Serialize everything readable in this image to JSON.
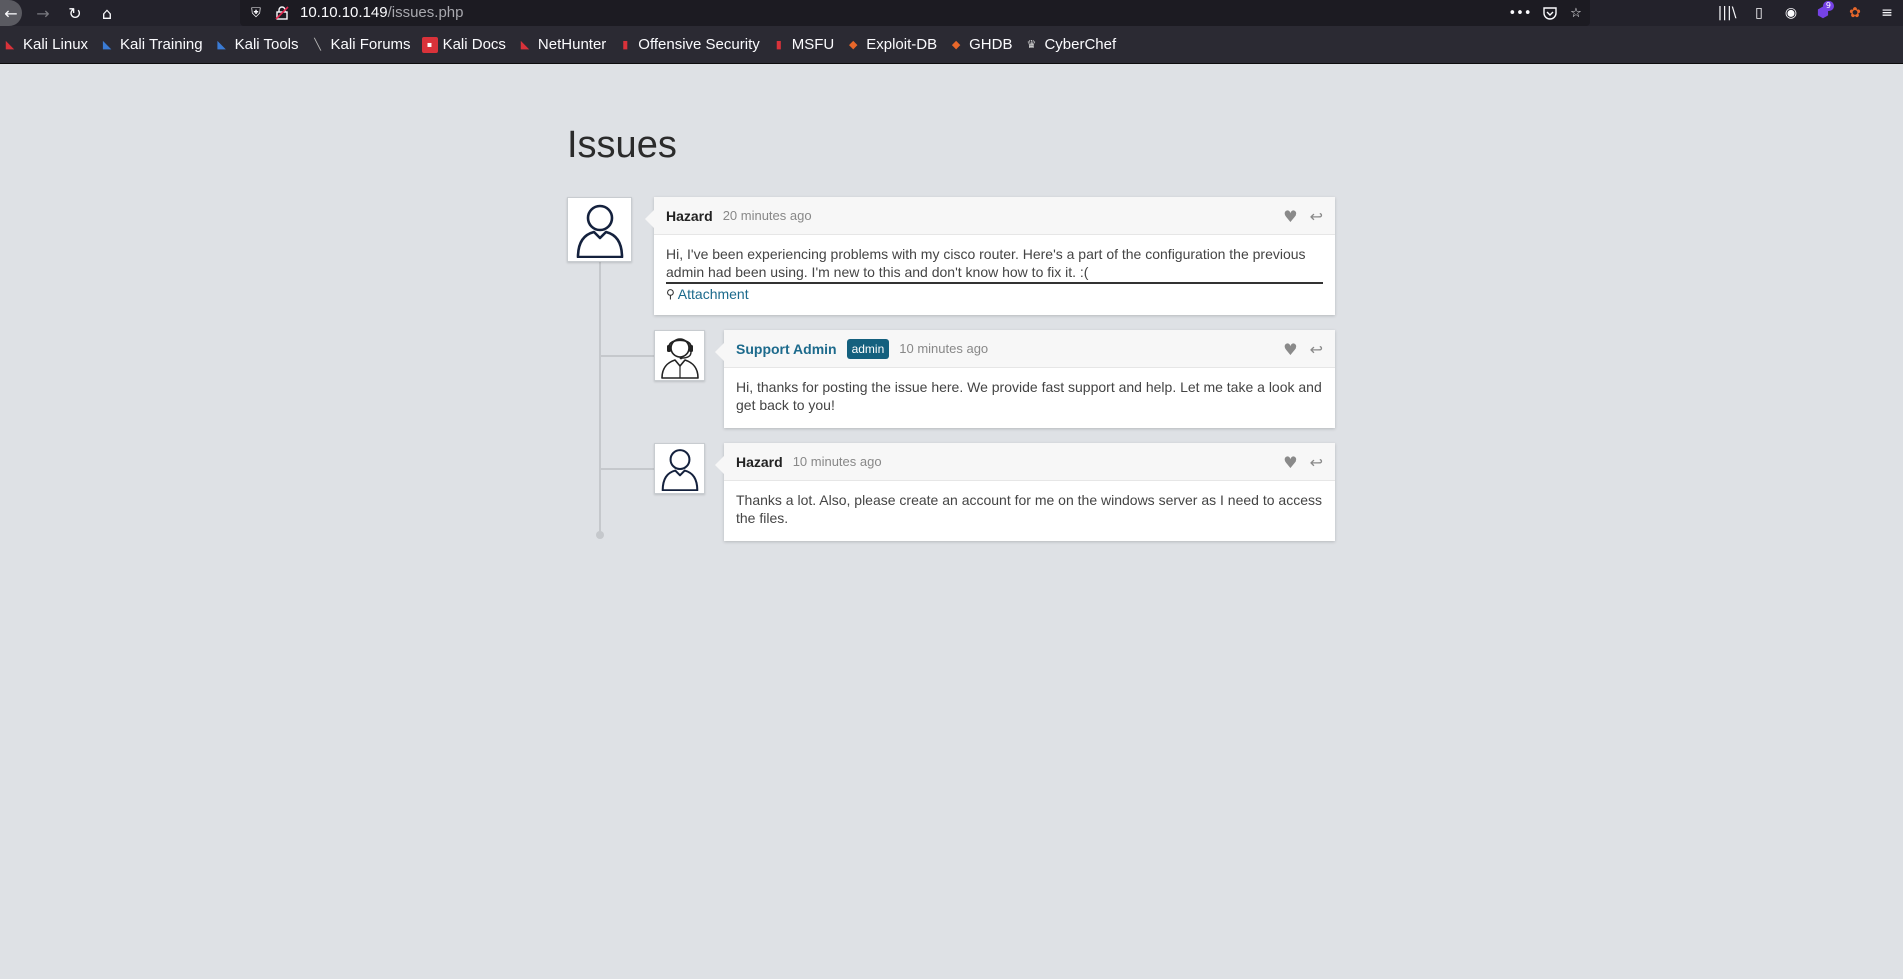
{
  "browser": {
    "url_host": "10.10.10.149",
    "url_path": "/issues.php",
    "notification_count": "9",
    "bookmarks": [
      {
        "label": "Kali Linux",
        "icon": "kali-dragon-icon",
        "color": "#d9323a"
      },
      {
        "label": "Kali Training",
        "icon": "kali-training-icon",
        "color": "#3a7bd5"
      },
      {
        "label": "Kali Tools",
        "icon": "kali-tools-icon",
        "color": "#3a7bd5"
      },
      {
        "label": "Kali Forums",
        "icon": "kali-forums-icon",
        "color": "#bbbbbb"
      },
      {
        "label": "Kali Docs",
        "icon": "kali-docs-icon",
        "color": "#d9323a"
      },
      {
        "label": "NetHunter",
        "icon": "nethunter-icon",
        "color": "#d9323a"
      },
      {
        "label": "Offensive Security",
        "icon": "offsec-icon",
        "color": "#d9323a"
      },
      {
        "label": "MSFU",
        "icon": "msfu-icon",
        "color": "#d9323a"
      },
      {
        "label": "Exploit-DB",
        "icon": "exploit-db-icon",
        "color": "#e8672a"
      },
      {
        "label": "GHDB",
        "icon": "ghdb-icon",
        "color": "#e8672a"
      },
      {
        "label": "CyberChef",
        "icon": "cyberchef-icon",
        "color": "#dddddd"
      }
    ]
  },
  "page": {
    "title": "Issues"
  },
  "comments": [
    {
      "author": "Hazard",
      "time": "20 minutes ago",
      "body": "Hi, I've been experiencing problems with my cisco router. Here's a part of the configuration the previous admin had been using. I'm new to this and don't know how to fix it. :(",
      "attachment": "Attachment",
      "avatar": "user-avatar-icon"
    },
    {
      "author": "Support Admin",
      "badge": "admin",
      "time": "10 minutes ago",
      "body": "Hi, thanks for posting the issue here. We provide fast support and help. Let me take a look and get back to you!",
      "avatar": "support-agent-avatar-icon"
    },
    {
      "author": "Hazard",
      "time": "10 minutes ago",
      "body": "Thanks a lot. Also, please create an account for me on the windows server as I need to access the files.",
      "avatar": "user-avatar-icon"
    }
  ],
  "colors": {
    "page_bg": "#dee1e5",
    "link": "#1c6a8c",
    "admin_badge": "#14607e"
  }
}
